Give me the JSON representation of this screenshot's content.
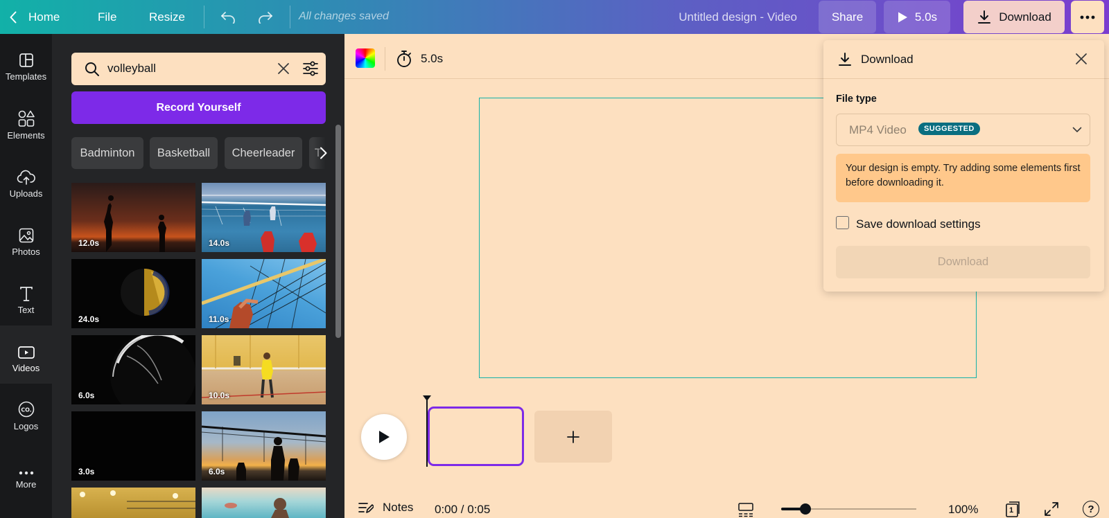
{
  "topbar": {
    "home": "Home",
    "file": "File",
    "resize": "Resize",
    "status": "All changes saved",
    "title": "Untitled design - Video",
    "share": "Share",
    "play_duration": "5.0s",
    "download": "Download"
  },
  "leftnav": {
    "items": [
      {
        "label": "Templates",
        "icon": "templates-icon"
      },
      {
        "label": "Elements",
        "icon": "elements-icon"
      },
      {
        "label": "Uploads",
        "icon": "uploads-icon"
      },
      {
        "label": "Photos",
        "icon": "photos-icon"
      },
      {
        "label": "Text",
        "icon": "text-icon"
      },
      {
        "label": "Videos",
        "icon": "videos-icon",
        "active": true
      },
      {
        "label": "Logos",
        "icon": "logos-icon"
      },
      {
        "label": "More",
        "icon": "more-icon"
      }
    ]
  },
  "panel": {
    "search_value": "volleyball",
    "record_label": "Record Yourself",
    "chips": [
      "Badminton",
      "Basketball",
      "Cheerleader",
      "T"
    ],
    "videos": [
      {
        "duration": "12.0s"
      },
      {
        "duration": "14.0s"
      },
      {
        "duration": "24.0s"
      },
      {
        "duration": "11.0s"
      },
      {
        "duration": "6.0s"
      },
      {
        "duration": "10.0s"
      },
      {
        "duration": "3.0s"
      },
      {
        "duration": "6.0s"
      }
    ]
  },
  "canvas": {
    "duration": "5.0s"
  },
  "timeline": {
    "notes": "Notes",
    "time": "0:00 / 0:05",
    "zoom": "100%",
    "zoom_level": 0.18,
    "page_number": "1",
    "help": "?"
  },
  "download_panel": {
    "title": "Download",
    "file_type_label": "File type",
    "file_type_value": "MP4 Video",
    "suggested_badge": "SUGGESTED",
    "warning": "Your design is empty. Try adding some elements first before downloading it.",
    "save_settings": "Save download settings",
    "save_settings_checked": false,
    "download_button": "Download"
  },
  "colors": {
    "accent_purple": "#7d2ae8",
    "teal": "#12b1a8",
    "panel_dark": "#242527",
    "canvas_bg": "#fde0c0",
    "warning_bg": "#ffc88b"
  }
}
